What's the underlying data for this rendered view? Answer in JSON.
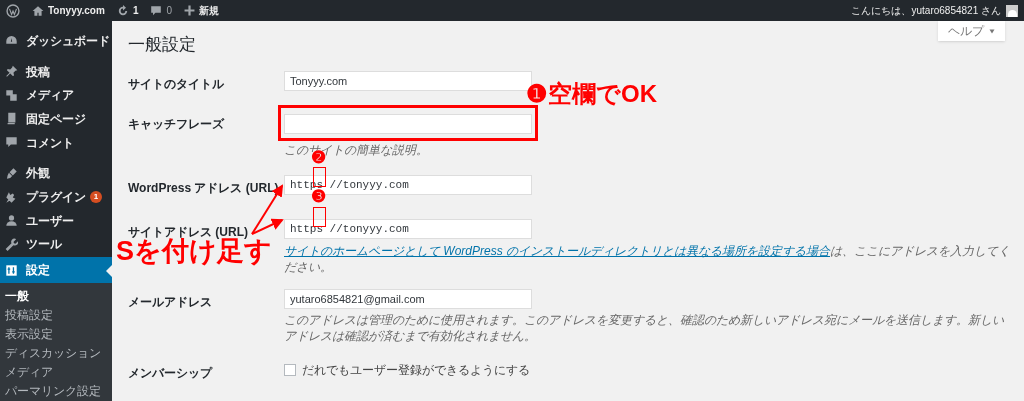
{
  "admin_bar": {
    "site_name": "Tonyyy.com",
    "updates_count": "1",
    "comments_count": "0",
    "new_label": "新規",
    "greeting": "こんにちは、yutaro6854821 さん"
  },
  "sidebar": {
    "items": [
      {
        "label": "ダッシュボード",
        "kind": "dashboard",
        "selected": false
      },
      {
        "label": "投稿",
        "kind": "pin",
        "selected": false
      },
      {
        "label": "メディア",
        "kind": "media",
        "selected": false
      },
      {
        "label": "固定ページ",
        "kind": "pages",
        "selected": false
      },
      {
        "label": "コメント",
        "kind": "comment",
        "selected": false
      },
      {
        "label": "外観",
        "kind": "brush",
        "selected": false
      },
      {
        "label": "プラグイン",
        "kind": "plug",
        "selected": false,
        "badge": "1"
      },
      {
        "label": "ユーザー",
        "kind": "user",
        "selected": false
      },
      {
        "label": "ツール",
        "kind": "wrench",
        "selected": false
      },
      {
        "label": "設定",
        "kind": "settings",
        "selected": true
      }
    ],
    "submenu": [
      {
        "label": "一般",
        "selected": true
      },
      {
        "label": "投稿設定",
        "selected": false
      },
      {
        "label": "表示設定",
        "selected": false
      },
      {
        "label": "ディスカッション",
        "selected": false
      },
      {
        "label": "メディア",
        "selected": false
      },
      {
        "label": "パーマリンク設定",
        "selected": false
      }
    ]
  },
  "help_button": "ヘルプ",
  "page_title": "一般設定",
  "fields": [
    {
      "kind": "text",
      "label": "サイトのタイトル",
      "value": "Tonyyy.com"
    },
    {
      "kind": "text",
      "label": "キャッチフレーズ",
      "highlighted": true,
      "description": "このサイトの簡単な説明。"
    },
    {
      "kind": "url",
      "label": "WordPress アドレス (URL)",
      "value": "https //tonyyy.com"
    },
    {
      "kind": "url",
      "label": "サイトアドレス (URL)",
      "value": "https //tonyyy.com",
      "description_link": "サイトのホームページとして WordPress のインストールディレクトリとは異なる場所を設定する場合",
      "description": "は、ここにアドレスを入力してください。"
    },
    {
      "kind": "text",
      "label": "メールアドレス",
      "value": "yutaro6854821@gmail.com",
      "description": "このアドレスは管理のために使用されます。このアドレスを変更すると、確認のため新しいアドレス宛にメールを送信します。新しいアドレスは確認が済むまで有効化されません。"
    },
    {
      "kind": "checkbox",
      "label": "メンバーシップ",
      "checked": false,
      "description": "だれでもユーザー登録ができるようにする"
    }
  ],
  "annotations": [
    {
      "kind": "callout",
      "text": "❶空欄でOK"
    },
    {
      "kind": "number",
      "text": "❷"
    },
    {
      "kind": "number",
      "text": "❸"
    },
    {
      "kind": "callout",
      "text": "Sを付け足す"
    }
  ]
}
